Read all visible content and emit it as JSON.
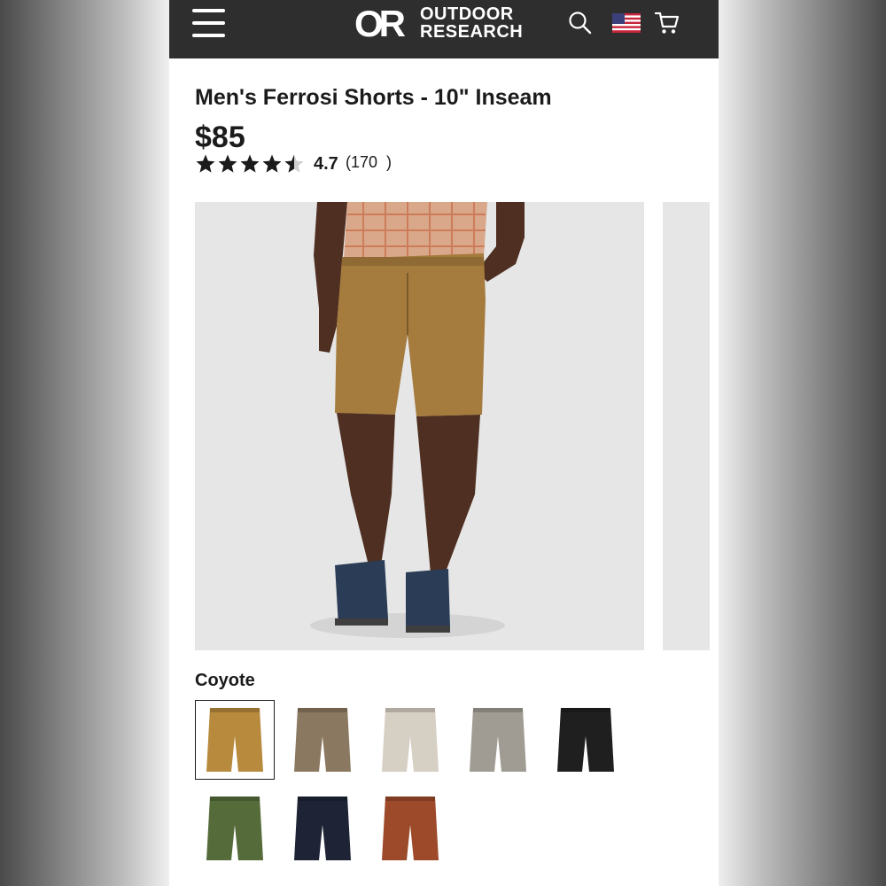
{
  "header": {
    "logo_mark": "OR",
    "logo_line1": "OUTDOOR",
    "logo_line2": "RESEARCH",
    "icons": [
      "menu-icon",
      "search-icon",
      "us-flag-icon",
      "cart-icon"
    ]
  },
  "product": {
    "title": "Men's Ferrosi Shorts - 10\" Inseam",
    "price": "$85",
    "rating": 4.7,
    "rating_label": "4.7",
    "review_count": "(170  )",
    "stars_filled": 4.5,
    "stars_max": 5
  },
  "colors": {
    "selected_label": "Coyote",
    "swatches": [
      {
        "fill": "#b88a3e",
        "selected": true
      },
      {
        "fill": "#8a7860",
        "selected": false
      },
      {
        "fill": "#d6cfc4",
        "selected": false
      },
      {
        "fill": "#a09c94",
        "selected": false
      },
      {
        "fill": "#1f1f1f",
        "selected": false
      },
      {
        "fill": "#556b3a",
        "selected": false
      },
      {
        "fill": "#1e2436",
        "selected": false
      },
      {
        "fill": "#9c4a2a",
        "selected": false
      }
    ]
  },
  "theme": {
    "header_bg": "#2e2e2e",
    "text": "#1b1b1b",
    "gallery_bg": "#e6e6e6"
  }
}
